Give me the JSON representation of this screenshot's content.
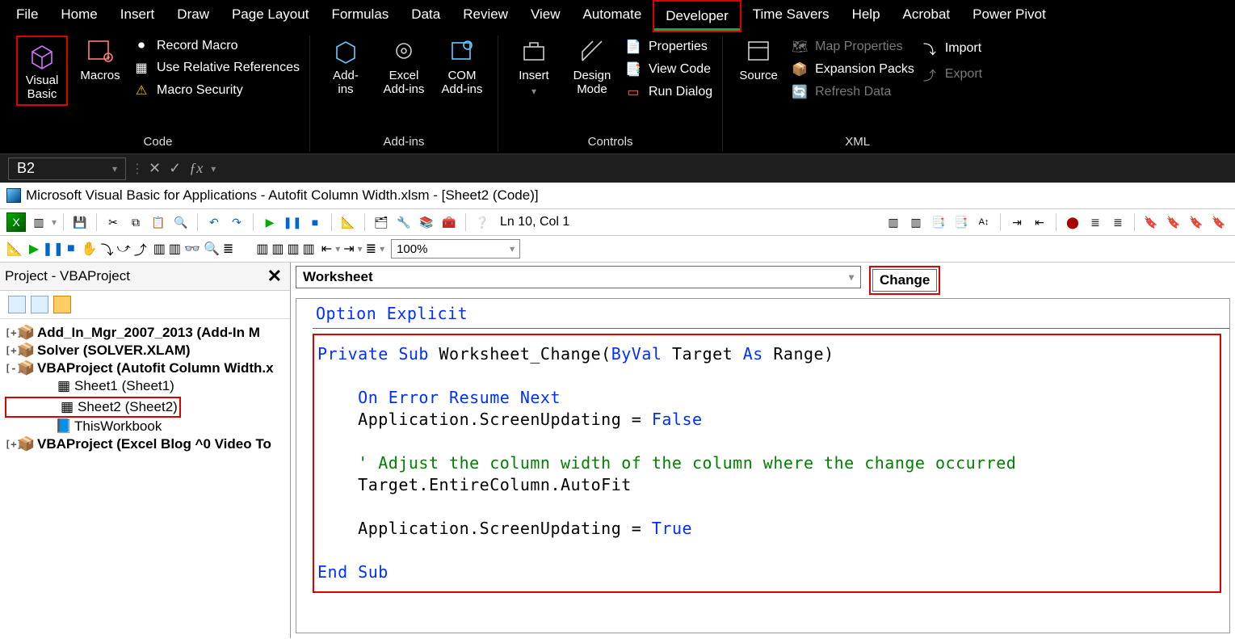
{
  "ribbon_tabs": [
    "File",
    "Home",
    "Insert",
    "Draw",
    "Page Layout",
    "Formulas",
    "Data",
    "Review",
    "View",
    "Automate",
    "Developer",
    "Time Savers",
    "Help",
    "Acrobat",
    "Power Pivot"
  ],
  "active_tab_index": 10,
  "groups": {
    "code": {
      "visual_basic": "Visual\nBasic",
      "macros": "Macros",
      "record_macro": "Record Macro",
      "use_relative": "Use Relative References",
      "macro_security": "Macro Security",
      "label": "Code"
    },
    "addins": {
      "addins": "Add-\nins",
      "excel_addins": "Excel\nAdd-ins",
      "com_addins": "COM\nAdd-ins",
      "label": "Add-ins"
    },
    "controls": {
      "insert": "Insert",
      "design_mode": "Design\nMode",
      "properties": "Properties",
      "view_code": "View Code",
      "run_dialog": "Run Dialog",
      "label": "Controls"
    },
    "xml": {
      "source": "Source",
      "map_properties": "Map Properties",
      "expansion_packs": "Expansion Packs",
      "refresh_data": "Refresh Data",
      "import": "Import",
      "export": "Export",
      "label": "XML"
    }
  },
  "name_box": "B2",
  "vbe": {
    "title": "Microsoft Visual Basic for Applications - Autofit Column Width.xlsm - [Sheet2 (Code)]",
    "cursor": "Ln 10, Col 1",
    "zoom": "100%",
    "project_pane_title": "Project - VBAProject",
    "tree": [
      {
        "text": "Add_In_Mgr_2007_2013 (Add-In M",
        "bold": true,
        "tw": "+",
        "ic": "pkg",
        "indent": 0
      },
      {
        "text": "Solver (SOLVER.XLAM)",
        "bold": true,
        "tw": "+",
        "ic": "pkg",
        "indent": 0
      },
      {
        "text": "VBAProject (Autofit Column Width.x",
        "bold": true,
        "tw": "-",
        "ic": "pkg",
        "indent": 0
      },
      {
        "text": "Sheet1 (Sheet1)",
        "bold": false,
        "tw": "",
        "ic": "sheet",
        "indent": 2
      },
      {
        "text": "Sheet2 (Sheet2)",
        "bold": false,
        "tw": "",
        "ic": "sheet",
        "indent": 2,
        "hl": true
      },
      {
        "text": "ThisWorkbook",
        "bold": false,
        "tw": "",
        "ic": "wb",
        "indent": 2
      },
      {
        "text": "VBAProject (Excel Blog ^0 Video To",
        "bold": true,
        "tw": "+",
        "ic": "pkg",
        "indent": 0
      }
    ],
    "object_dd": "Worksheet",
    "proc_dd": "Change",
    "option_line": "Option Explicit",
    "code_tokens": [
      [
        {
          "t": "Private Sub",
          "c": "kw"
        },
        {
          "t": " Worksheet_Change(",
          "c": "tx"
        },
        {
          "t": "ByVal",
          "c": "kw"
        },
        {
          "t": " Target ",
          "c": "tx"
        },
        {
          "t": "As",
          "c": "kw"
        },
        {
          "t": " Range)",
          "c": "tx"
        }
      ],
      [],
      [
        {
          "t": "    On Error Resume Next",
          "c": "kw"
        }
      ],
      [
        {
          "t": "    Application.ScreenUpdating = ",
          "c": "tx"
        },
        {
          "t": "False",
          "c": "kw"
        }
      ],
      [],
      [
        {
          "t": "    ' Adjust the column width of the column where the change occurred",
          "c": "cm"
        }
      ],
      [
        {
          "t": "    Target.EntireColumn.AutoFit",
          "c": "tx"
        }
      ],
      [],
      [
        {
          "t": "    Application.ScreenUpdating = ",
          "c": "tx"
        },
        {
          "t": "True",
          "c": "kw"
        }
      ],
      [],
      [
        {
          "t": "End Sub",
          "c": "kw"
        }
      ]
    ]
  }
}
